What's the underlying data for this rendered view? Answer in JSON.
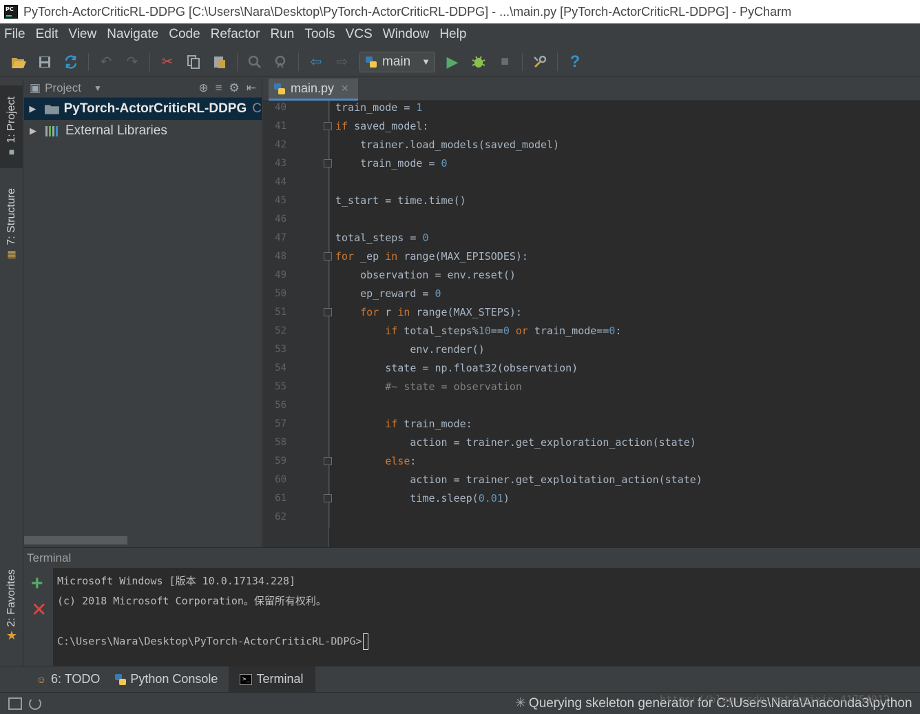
{
  "window": {
    "title": "PyTorch-ActorCriticRL-DDPG [C:\\Users\\Nara\\Desktop\\PyTorch-ActorCriticRL-DDPG] - ...\\main.py [PyTorch-ActorCriticRL-DDPG] - PyCharm"
  },
  "menu": [
    "File",
    "Edit",
    "View",
    "Navigate",
    "Code",
    "Refactor",
    "Run",
    "Tools",
    "VCS",
    "Window",
    "Help"
  ],
  "toolbar": {
    "run_config": "main",
    "help": "?"
  },
  "left_strip": {
    "project_tab": "1: Project",
    "structure_tab": "7: Structure",
    "favorites_tab": "2: Favorites"
  },
  "project_panel": {
    "header": "Project",
    "items": [
      {
        "label": "PyTorch-ActorCriticRL-DDPG",
        "more": "C"
      },
      {
        "label": "External Libraries"
      }
    ]
  },
  "editor": {
    "tab": "main.py",
    "lines": [
      {
        "num": "40",
        "code": "train_mode = 1"
      },
      {
        "num": "41",
        "code": "if saved_model:"
      },
      {
        "num": "42",
        "code": "    trainer.load_models(saved_model)"
      },
      {
        "num": "43",
        "code": "    train_mode = 0"
      },
      {
        "num": "44",
        "code": ""
      },
      {
        "num": "45",
        "code": "t_start = time.time()"
      },
      {
        "num": "46",
        "code": ""
      },
      {
        "num": "47",
        "code": "total_steps = 0"
      },
      {
        "num": "48",
        "code": "for _ep in range(MAX_EPISODES):"
      },
      {
        "num": "49",
        "code": "    observation = env.reset()"
      },
      {
        "num": "50",
        "code": "    ep_reward = 0"
      },
      {
        "num": "51",
        "code": "    for r in range(MAX_STEPS):"
      },
      {
        "num": "52",
        "code": "        if total_steps%10==0 or train_mode==0:"
      },
      {
        "num": "53",
        "code": "            env.render()"
      },
      {
        "num": "54",
        "code": "        state = np.float32(observation)"
      },
      {
        "num": "55",
        "code": "        #~ state = observation"
      },
      {
        "num": "56",
        "code": ""
      },
      {
        "num": "57",
        "code": "        if train_mode:"
      },
      {
        "num": "58",
        "code": "            action = trainer.get_exploration_action(state)"
      },
      {
        "num": "59",
        "code": "        else:"
      },
      {
        "num": "60",
        "code": "            action = trainer.get_exploitation_action(state)"
      },
      {
        "num": "61",
        "code": "            time.sleep(0.01)"
      },
      {
        "num": "62",
        "code": ""
      }
    ]
  },
  "terminal": {
    "header": "Terminal",
    "lines": [
      "Microsoft Windows [版本 10.0.17134.228]",
      "(c) 2018 Microsoft Corporation。保留所有权利。",
      "",
      "C:\\Users\\Nara\\Desktop\\PyTorch-ActorCriticRL-DDPG>"
    ]
  },
  "bottom_tabs": [
    {
      "label": "6: TODO"
    },
    {
      "label": "Python Console"
    },
    {
      "label": "Terminal"
    }
  ],
  "status": {
    "message": "Querying skeleton generator for C:\\Users\\Nara\\Anaconda3\\python",
    "watermark": "https://blog.csdn.net/weixin_41754912"
  },
  "colors": {
    "keyword": "#cc7832",
    "number": "#6897bb",
    "comment": "#808080",
    "text": "#a9b7c6",
    "selection": "#0d293e"
  }
}
